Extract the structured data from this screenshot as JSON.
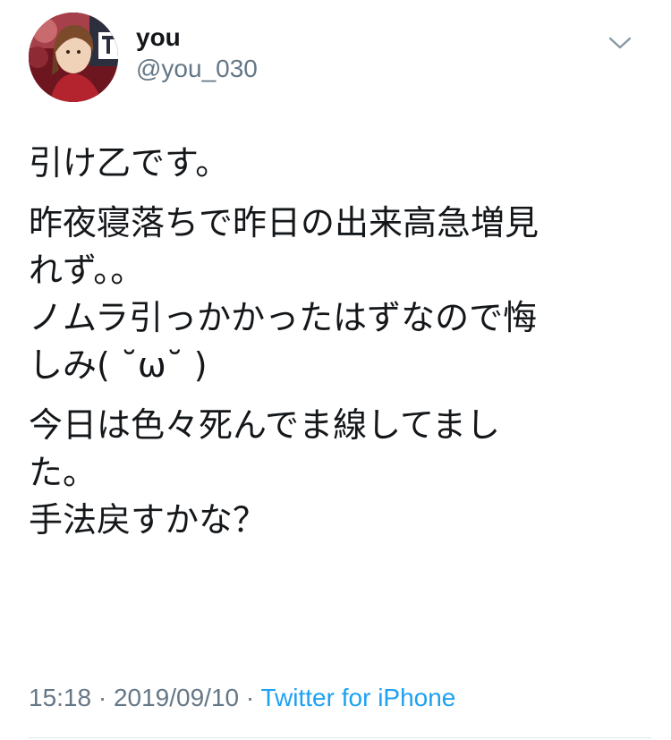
{
  "user": {
    "display_name": "you",
    "handle": "@you_030",
    "avatar": "profile-avatar"
  },
  "tweet": {
    "paragraphs": [
      [
        "引け乙です。"
      ],
      [
        "昨夜寝落ちで昨日の出来高急増見",
        "れず。。",
        "ノムラ引っかかったはずなので悔",
        "しみ( ˘ω˘ )"
      ],
      [
        "今日は色々死んでま線してまし",
        "た。",
        "手法戻すかな？"
      ]
    ]
  },
  "meta": {
    "time": "15:18",
    "separator1": " · ",
    "date": "2019/09/10",
    "separator2": " · ",
    "source": "Twitter for iPhone"
  },
  "icons": {
    "menu": "chevron-down-icon"
  },
  "colors": {
    "text": "#14171a",
    "secondary": "#657786",
    "link": "#1da1f2",
    "divider": "#e1e8ed"
  }
}
